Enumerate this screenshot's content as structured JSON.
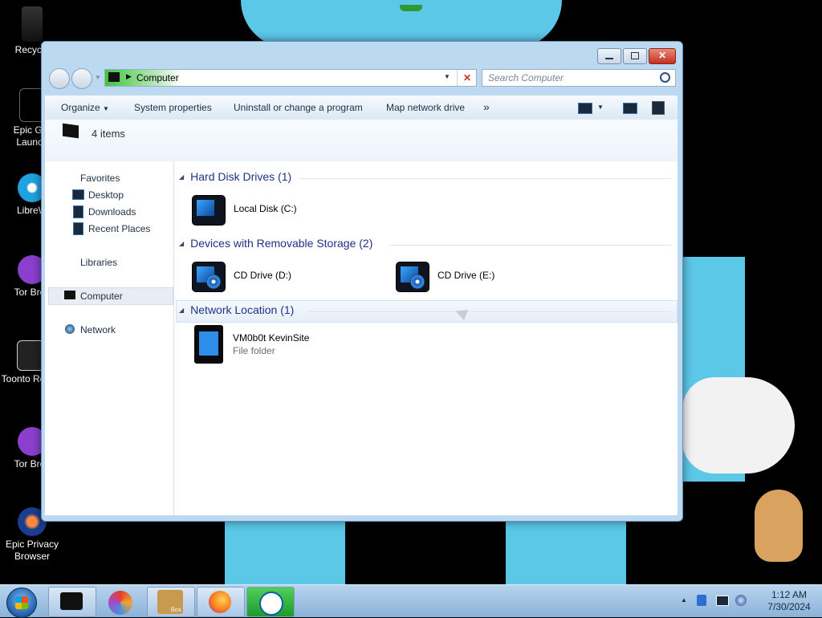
{
  "desktop": {
    "icons": [
      {
        "label": "Recycle"
      },
      {
        "label": "Epic Gar Launch"
      },
      {
        "label": "LibreW"
      },
      {
        "label": "Tor Brov"
      },
      {
        "label": "Toonto Rewritt"
      },
      {
        "label": "Tor Brov"
      },
      {
        "label": "Epic Privacy Browser"
      }
    ]
  },
  "window": {
    "address": {
      "path_item": "Computer"
    },
    "search": {
      "placeholder": "Search Computer"
    },
    "toolbar": {
      "organize": "Organize",
      "system_properties": "System properties",
      "uninstall": "Uninstall or change a program",
      "map_drive": "Map network drive",
      "more": "»"
    },
    "info": {
      "count": "4 items"
    },
    "nav": {
      "favorites": "Favorites",
      "desktop": "Desktop",
      "downloads": "Downloads",
      "recent": "Recent Places",
      "libraries": "Libraries",
      "computer": "Computer",
      "network": "Network"
    },
    "groups": [
      {
        "title": "Hard Disk Drives (1)",
        "items": [
          {
            "name": "Local Disk (C:)"
          }
        ]
      },
      {
        "title": "Devices with Removable Storage (2)",
        "items": [
          {
            "name": "CD Drive (D:)"
          },
          {
            "name": "CD Drive (E:)"
          }
        ]
      },
      {
        "title": "Network Location (1)",
        "items": [
          {
            "name": "VM0b0t KevinSite",
            "type": "File folder"
          }
        ]
      }
    ]
  },
  "taskbar": {
    "clock_time": "1:12 AM",
    "clock_date": "7/30/2024",
    "pinned_box_label": "Box",
    "tray_arrow": "▲"
  },
  "colors": {
    "accent": "#1e3287",
    "wallpaper_blue": "#5cc8e8",
    "window_frame": "#bcd9f2"
  }
}
